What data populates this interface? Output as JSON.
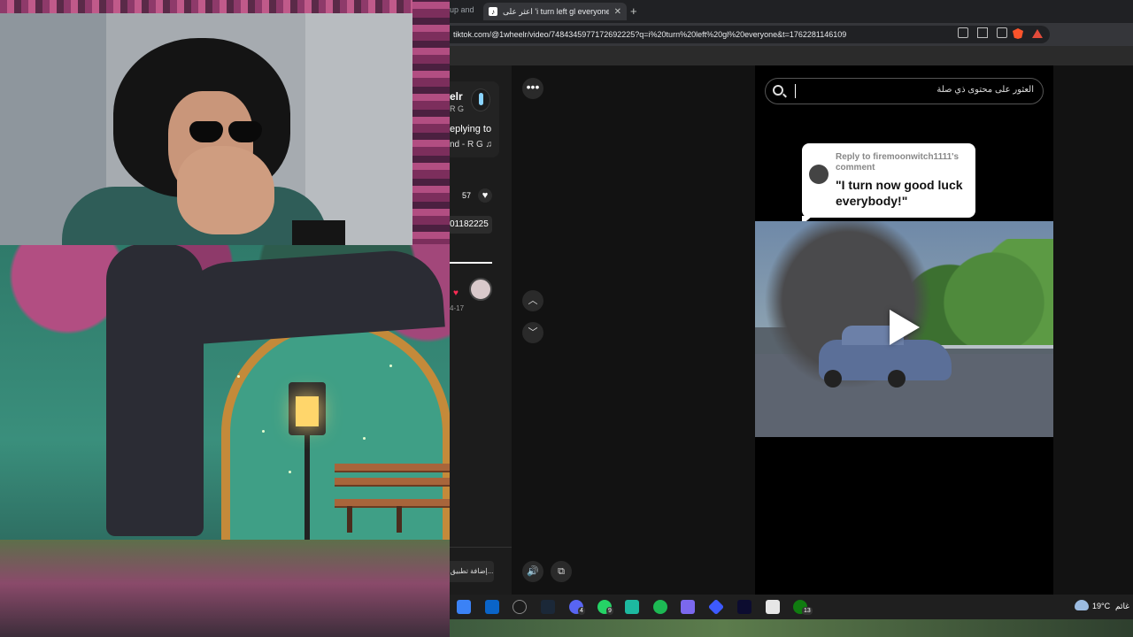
{
  "browser": {
    "prev_tab_title": "up and",
    "active_tab": {
      "title": "اعثر على 'i turn left gl everyone'",
      "favicon": "tiktok-icon"
    },
    "new_tab_label": "+",
    "url": "tiktok.com/@1wheelr/video/7484345977172692225?q=i%20turn%20left%20gl%20everyone&t=1762281146109"
  },
  "left_panel": {
    "author_name": "elr",
    "author_sub": "R G",
    "replying_text": "eplying to",
    "music_text": "nd - R G ♫",
    "likes": "57",
    "heart_glyph": "♥",
    "code": "01182225",
    "comment_date": "4-17",
    "add_app_label": "إضافة تطبيق..."
  },
  "controls": {
    "more": "•••",
    "up": "︿",
    "down": "﹀",
    "sound": "🔊",
    "pip": "⧉"
  },
  "video": {
    "search_placeholder": "العثور على محتوى ذي صلة",
    "reply_to": "Reply to firemoonwitch1111's comment",
    "reply_quote": "\"I turn now good luck everybody!\""
  },
  "taskbar": {
    "items": [
      {
        "name": "start-icon",
        "color": "#3b82f6"
      },
      {
        "name": "outlook-icon",
        "color": "#0a64c8"
      },
      {
        "name": "browser-icon",
        "color": "#1b1b1b"
      },
      {
        "name": "steam-icon",
        "color": "#1b2838"
      },
      {
        "name": "discord-icon",
        "color": "#5865f2"
      },
      {
        "name": "whatsapp-icon",
        "color": "#25d366"
      },
      {
        "name": "app-icon",
        "color": "#1db9a0"
      },
      {
        "name": "spotify-icon",
        "color": "#1db954"
      },
      {
        "name": "game-icon",
        "color": "#7b68ee"
      },
      {
        "name": "vpn-icon",
        "color": "#3d5afe"
      },
      {
        "name": "terminal-icon",
        "color": "#0c0c30"
      },
      {
        "name": "notes-icon",
        "color": "#e6e6e6"
      },
      {
        "name": "xbox-icon",
        "color": "#107c10"
      }
    ],
    "badges": {
      "discord": "4",
      "whatsapp": "9",
      "xbox": "13"
    },
    "weather_temp": "19°C",
    "weather_label": "غائم"
  }
}
